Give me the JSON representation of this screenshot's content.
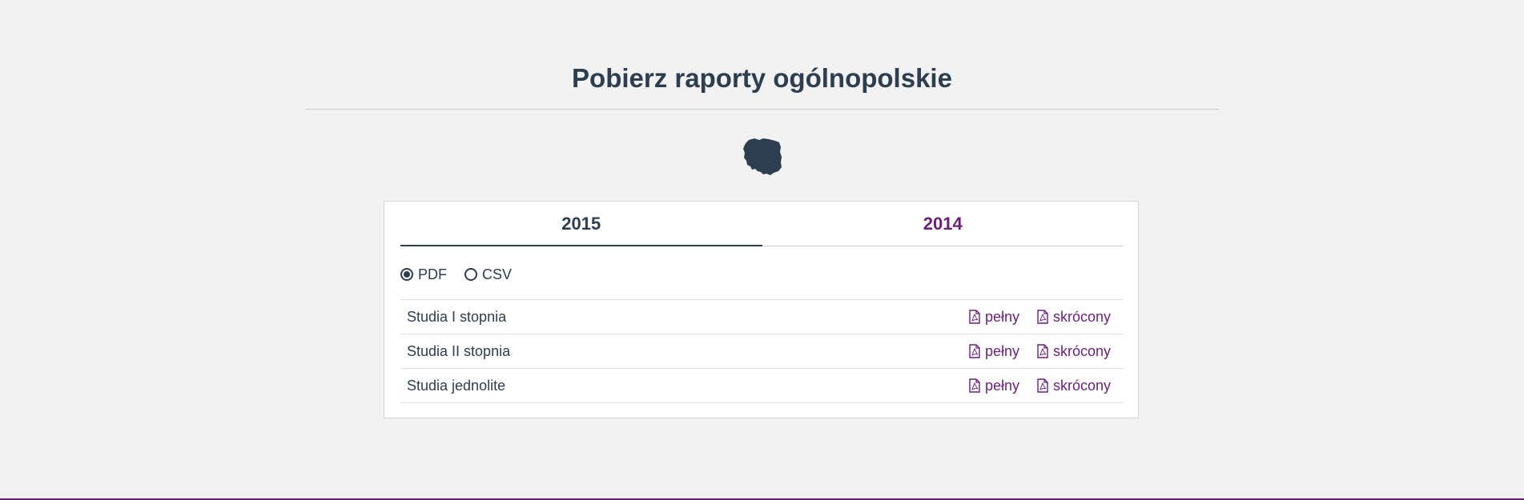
{
  "page": {
    "title": "Pobierz raporty ogólnopolskie",
    "map_icon": "poland-map-icon"
  },
  "tabs": [
    {
      "label": "2015",
      "active": true
    },
    {
      "label": "2014",
      "active": false
    }
  ],
  "format": {
    "options": [
      {
        "label": "PDF",
        "checked": true
      },
      {
        "label": "CSV",
        "checked": false
      }
    ]
  },
  "reports": [
    {
      "label": "Studia I stopnia",
      "full_label": "pełny",
      "short_label": "skrócony"
    },
    {
      "label": "Studia II stopnia",
      "full_label": "pełny",
      "short_label": "skrócony"
    },
    {
      "label": "Studia jednolite",
      "full_label": "pełny",
      "short_label": "skrócony"
    }
  ],
  "colors": {
    "text": "#2c3e50",
    "accent": "#6a1f7a",
    "background": "#f2f2f2"
  }
}
